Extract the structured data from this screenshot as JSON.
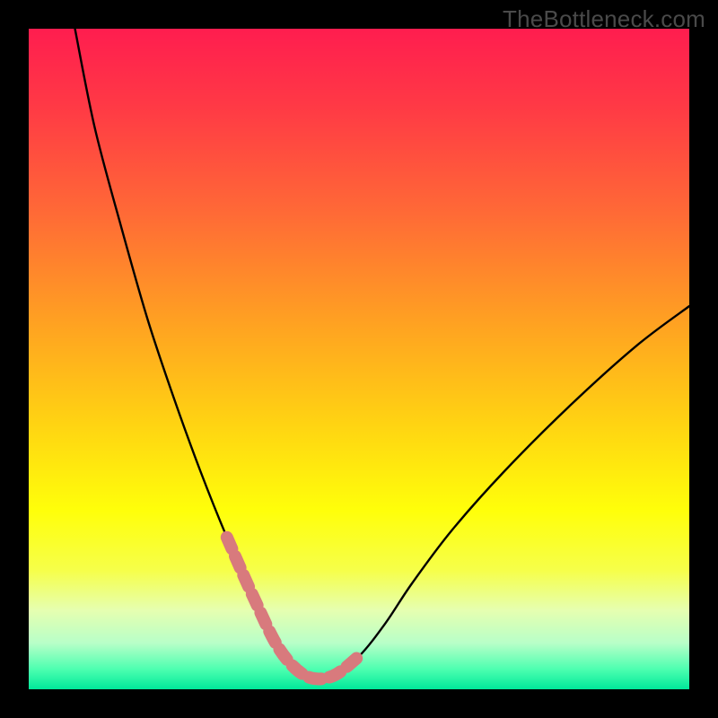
{
  "watermark": "TheBottleneck.com",
  "colors": {
    "frame": "#000000",
    "curve": "#000000",
    "highlight": "#d87a7d",
    "gradient_stops": [
      {
        "offset": 0.0,
        "color": "#ff1d4f"
      },
      {
        "offset": 0.12,
        "color": "#ff3a45"
      },
      {
        "offset": 0.28,
        "color": "#ff6a36"
      },
      {
        "offset": 0.45,
        "color": "#ffa321"
      },
      {
        "offset": 0.6,
        "color": "#ffd412"
      },
      {
        "offset": 0.73,
        "color": "#ffff0a"
      },
      {
        "offset": 0.82,
        "color": "#f6ff4a"
      },
      {
        "offset": 0.88,
        "color": "#e6ffb0"
      },
      {
        "offset": 0.93,
        "color": "#b8ffc8"
      },
      {
        "offset": 0.97,
        "color": "#4cffb0"
      },
      {
        "offset": 1.0,
        "color": "#00e89a"
      }
    ]
  },
  "chart_data": {
    "type": "line",
    "title": "",
    "xlabel": "",
    "ylabel": "",
    "xlim": [
      0,
      100
    ],
    "ylim": [
      0,
      100
    ],
    "grid": false,
    "legend": false,
    "description": "V-shaped bottleneck curve. Y is an implied metric (lower is better), X is an implied parameter. The curve drops steeply from the top-left, reaches a flat minimum around x≈37–47, then rises more gently toward the right. Background is a vertical red→yellow→green severity gradient (red = high bottleneck at top, green = optimal at bottom). The segment near the minimum (roughly x≈30–52) is highlighted in salmon.",
    "series": [
      {
        "name": "bottleneck-curve",
        "x": [
          7,
          10,
          14,
          18,
          22,
          26,
          30,
          34,
          38,
          42,
          46,
          50,
          54,
          58,
          64,
          72,
          82,
          92,
          100
        ],
        "y": [
          100,
          85,
          70,
          56,
          44,
          33,
          23,
          14,
          6,
          2,
          2,
          5,
          10,
          16,
          24,
          33,
          43,
          52,
          58
        ]
      }
    ],
    "highlight_x_range": [
      30,
      52
    ],
    "annotations": [
      {
        "text": "TheBottleneck.com",
        "role": "watermark",
        "position": "top-right"
      }
    ]
  }
}
